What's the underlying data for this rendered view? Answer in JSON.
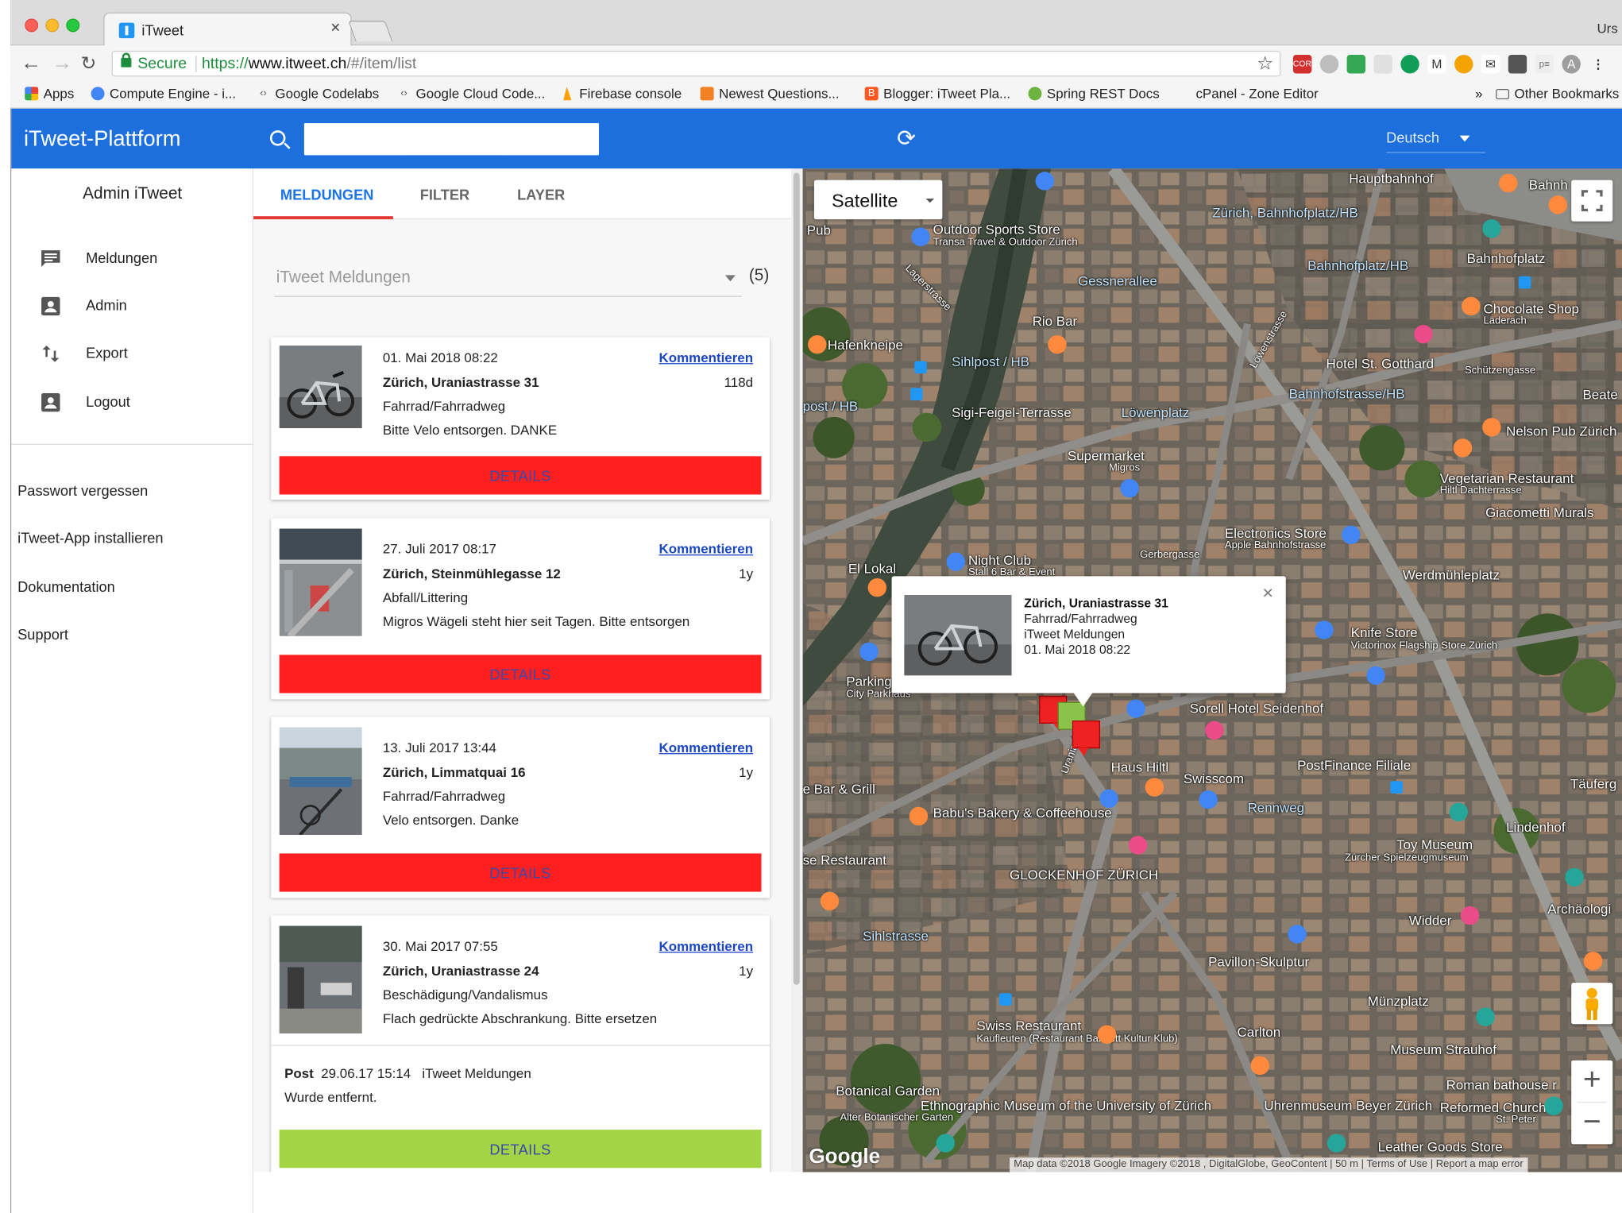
{
  "browser": {
    "tab_title": "iTweet",
    "tab_close": "×",
    "profile": "Urs",
    "secure_label": "Secure",
    "url_scheme": "https://",
    "url_host": "www.itweet.ch",
    "url_path": "/#/item/list",
    "bookmarks": [
      {
        "label": "Apps",
        "icon": "apps-grid-icon",
        "color": "#d93025"
      },
      {
        "label": "Compute Engine - i...",
        "icon": "compute-engine-icon",
        "color": "#4285f4"
      },
      {
        "label": "Google Codelabs",
        "icon": "code-brackets-icon",
        "color": "#555555"
      },
      {
        "label": "Google Cloud Code...",
        "icon": "code-brackets-icon",
        "color": "#555555"
      },
      {
        "label": "Firebase console",
        "icon": "firebase-icon",
        "color": "#ffa000"
      },
      {
        "label": "Newest Questions...",
        "icon": "stackoverflow-icon",
        "color": "#f48024"
      },
      {
        "label": "Blogger: iTweet Pla...",
        "icon": "blogger-icon",
        "color": "#ff5722"
      },
      {
        "label": "Spring REST Docs",
        "icon": "spring-icon",
        "color": "#6db33f"
      },
      {
        "label": "cPanel - Zone Editor",
        "icon": "",
        "color": ""
      }
    ],
    "bookmarks_more": "»",
    "other_bookmarks": "Other Bookmarks"
  },
  "app": {
    "title": "iTweet-Plattform",
    "search_placeholder": "",
    "language": "Deutsch",
    "colors": {
      "primary": "#1c6fdc",
      "accent": "#e53935",
      "details_red": "#ff1f1f",
      "details_green": "#a2d444",
      "link": "#1a46c8"
    }
  },
  "sidebar": {
    "user": "Admin iTweet",
    "items": [
      {
        "label": "Meldungen",
        "icon": "message-icon"
      },
      {
        "label": "Admin",
        "icon": "account-box-icon"
      },
      {
        "label": "Export",
        "icon": "import-export-icon"
      },
      {
        "label": "Logout",
        "icon": "account-box-icon"
      }
    ],
    "links": [
      "Passwort vergessen",
      "iTweet-App installieren",
      "Dokumentation",
      "Support"
    ]
  },
  "list": {
    "tabs": [
      "MELDUNGEN",
      "FILTER",
      "LAYER"
    ],
    "active_tab": "MELDUNGEN",
    "select_value": "iTweet Meldungen",
    "count": "(5)",
    "comment_label": "Kommentieren",
    "details_label": "DETAILS",
    "cards": [
      {
        "date": "01. Mai 2018 08:22",
        "address": "Zürich, Uraniastrasse 31",
        "category": "Fahrrad/Fahrradweg",
        "description": "Bitte Velo entsorgen. DANKE",
        "age": "118d",
        "status": "red"
      },
      {
        "date": "27. Juli 2017 08:17",
        "address": "Zürich, Steinmühlegasse 12",
        "category": "Abfall/Littering",
        "description": "Migros Wägeli steht hier seit Tagen. Bitte entsorgen",
        "age": "1y",
        "status": "red"
      },
      {
        "date": "13. Juli 2017 13:44",
        "address": "Zürich, Limmatquai 16",
        "category": "Fahrrad/Fahrradweg",
        "description": "Velo entsorgen. Danke",
        "age": "1y",
        "status": "red"
      },
      {
        "date": "30. Mai 2017 07:55",
        "address": "Zürich, Uraniastrasse 24",
        "category": "Beschädigung/Vandalismus",
        "description": "Flach gedrückte Abschrankung. Bitte ersetzen",
        "age": "1y",
        "status": "green",
        "post": {
          "label": "Post",
          "timestamp": "29.06.17 15:14",
          "source": "iTweet Meldungen",
          "text": "Wurde entfernt."
        }
      }
    ]
  },
  "map": {
    "type_label": "Satellite",
    "popup": {
      "address": "Zürich, Uraniastrasse 31",
      "category": "Fahrrad/Fahrradweg",
      "layer": "iTweet Meldungen",
      "date": "01. Mai 2018 08:22",
      "close": "×"
    },
    "zoom_in": "+",
    "zoom_out": "−",
    "logo": "Google",
    "attribution": "Map data ©2018 Google Imagery ©2018 , DigitalGlobe, GeoContent  |  50 m  |  Terms of Use  |  Report a map error",
    "labels": [
      "Hauptbahnhof",
      "Outdoor Sports Store",
      "Transa Travel & Outdoor Zürich",
      "Zürich, Bahnhofplatz/HB",
      "Bahnhofplatz",
      "Gessnerallee",
      "Bahnhofplatz/HB",
      "Chocolate Shop",
      "Läderach",
      "Pub",
      "Hafenkneipe",
      "Rio Bar",
      "Sihlpost / HB",
      "Hotel St. Gotthard",
      "Schützengasse",
      "post / HB",
      "Sigi-Feigel-Terrasse",
      "Löwenplatz",
      "Bahnhofstrasse/HB",
      "Nelson Pub Zürich",
      "Beate",
      "Supermarket",
      "Migros",
      "Vegetarian Restaurant",
      "Hiltl Dachterrasse",
      "Giacometti Murals",
      "Electronics Store",
      "Apple Bahnhofstrasse",
      "Gerbergasse",
      "El Lokal",
      "Night Club",
      "Stall 6 Bar & Event",
      "Werdmühleplatz",
      "Knife Store",
      "Victorinox Flagship Store Zürich",
      "Parking",
      "City Parkhaus",
      "Sorell Hotel Seidenhof",
      "Haus Hiltl",
      "PostFinance Filiale",
      "Swisscom",
      "e Bar & Grill",
      "Babu's Bakery & Coffeehouse",
      "Rennweg",
      "Täuferg",
      "Lindenhof",
      "Toy Museum",
      "Zürcher Spielzeugmuseum",
      "se Restaurant",
      "GLOCKENHOF ZÜRICH",
      "Widder",
      "Archäologi",
      "Sihlstrasse",
      "Pavillon-Skulptur",
      "Münzplatz",
      "Swiss Restaurant",
      "Kaufleuten (Restaurant Bankett Kultur Klub)",
      "Carlton",
      "Museum Strauhof",
      "Roman bathouse r",
      "Botanical Garden",
      "Alter Botanischer Garten",
      "Ethnographic Museum of the University of Zürich",
      "Uhrenmuseum Beyer Zürich",
      "Reformed Church",
      "St. Peter",
      "Leather Goods Store",
      "Uraniastr",
      "Lagerstrasse",
      "Bahnh",
      "Löwenstrasse",
      "Uraniastrasse"
    ]
  }
}
